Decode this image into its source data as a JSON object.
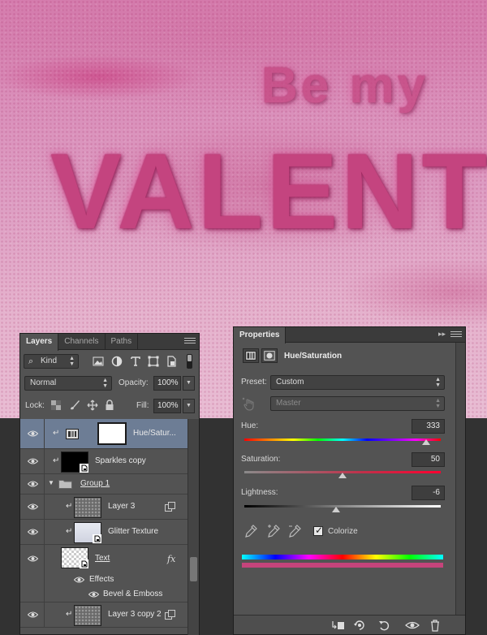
{
  "artwork": {
    "line1": "Be my",
    "line2": "VALENT"
  },
  "layers_panel": {
    "tabs": [
      "Layers",
      "Channels",
      "Paths"
    ],
    "filter_kind": "Kind",
    "blend_mode": "Normal",
    "opacity_label": "Opacity:",
    "opacity_value": "100%",
    "lock_label": "Lock:",
    "fill_label": "Fill:",
    "fill_value": "100%",
    "layers": [
      {
        "name": "Hue/Satur...",
        "selected": true
      },
      {
        "name": "Sparkles copy"
      },
      {
        "name": "Group 1"
      },
      {
        "name": "Layer 3"
      },
      {
        "name": "Glitter Texture"
      },
      {
        "name": "Text",
        "fx": "fx"
      },
      {
        "name": "Effects"
      },
      {
        "name": "Bevel & Emboss"
      },
      {
        "name": "Layer 3 copy 2"
      }
    ]
  },
  "properties_panel": {
    "title": "Properties",
    "adjustment_name": "Hue/Saturation",
    "preset_label": "Preset:",
    "preset_value": "Custom",
    "channel_value": "Master",
    "hue_label": "Hue:",
    "hue_value": "333",
    "saturation_label": "Saturation:",
    "saturation_value": "50",
    "lightness_label": "Lightness:",
    "lightness_value": "-6",
    "colorize_label": "Colorize",
    "colorize_checked": true
  },
  "colors": {
    "panel_bg": "#535353",
    "selected_row": "#6d7d95",
    "glitter_pink": "#c4447f"
  }
}
